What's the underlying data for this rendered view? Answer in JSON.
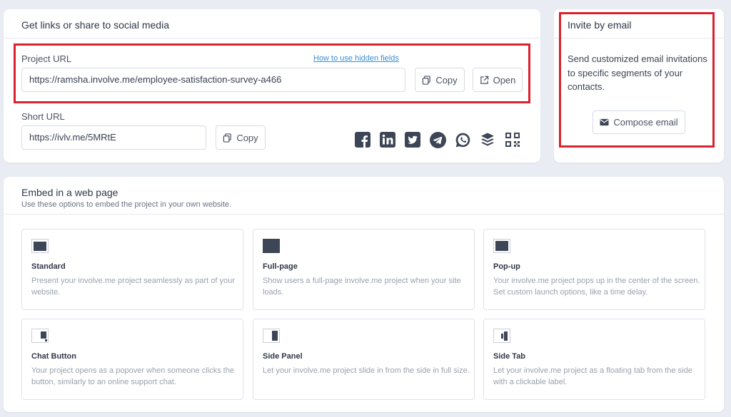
{
  "share": {
    "title": "Get links or share to social media",
    "project_url_label": "Project URL",
    "hidden_fields_link": "How to use hidden fields",
    "project_url_value": "https://ramsha.involve.me/employee-satisfaction-survey-a466",
    "copy_label": "Copy",
    "open_label": "Open",
    "short_url_label": "Short URL",
    "short_url_value": "https://ivlv.me/5MRtE",
    "short_copy_label": "Copy",
    "social_icons": [
      "facebook-icon",
      "linkedin-icon",
      "twitter-icon",
      "telegram-icon",
      "whatsapp-icon",
      "buffer-icon",
      "qr-code-icon"
    ]
  },
  "invite": {
    "title": "Invite by email",
    "description": "Send customized email invitations to specific segments of your contacts.",
    "compose_label": "Compose email"
  },
  "embed": {
    "title": "Embed in a web page",
    "subtitle": "Use these options to embed the project in your own website.",
    "options": [
      {
        "name": "Standard",
        "description": "Present your involve.me project seamlessly as part of your website."
      },
      {
        "name": "Full-page",
        "description": "Show users a full-page involve.me project when your site loads."
      },
      {
        "name": "Pop-up",
        "description": "Your involve.me project pops up in the center of the screen. Set custom launch options, like a time delay."
      },
      {
        "name": "Chat Button",
        "description": "Your project opens as a popover when someone clicks the button, similarly to an online support chat."
      },
      {
        "name": "Side Panel",
        "description": "Let your involve.me project slide in from the side in full size."
      },
      {
        "name": "Side Tab",
        "description": "Let your involve.me project as a floating tab from the side with a clickable label."
      }
    ]
  },
  "colors": {
    "background": "#e9ecf2",
    "highlight": "#d8232f",
    "link": "#3a8fd6",
    "icon_dark": "#3d4657"
  }
}
